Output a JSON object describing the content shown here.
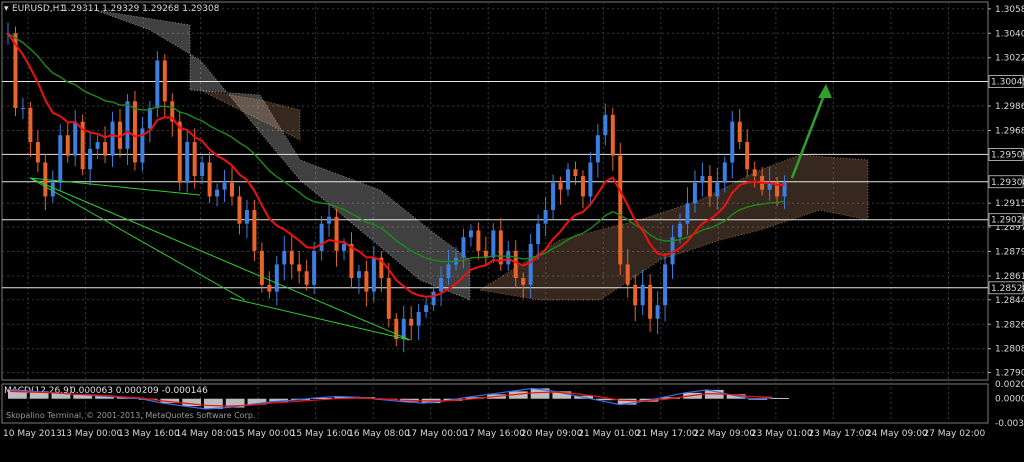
{
  "header": {
    "symbol_text": "EURUSD,H1",
    "ohlc_text": "1.29311 1.29329 1.29268 1.29308"
  },
  "macd_header": {
    "label": "MACD(12,26,9)",
    "values": "0.000063 0.000209 -0.000146"
  },
  "copyright": "Skopalino Terminal, © 2001-2013, MetaQuotes Software Corp.",
  "colors": {
    "bull_candle": "#3d7fe0",
    "bear_candle": "#e8642a",
    "ema_fast": "#ee1111",
    "ema_slow": "#1d8a1d",
    "cloud_white": "#e6e6e6",
    "cloud_orange": "#d9a079",
    "support_line": "#32cd32",
    "arrow": "#2da12d",
    "hline": "#e6e6e6",
    "macd_hist": "#bdbdbd",
    "macd_main": "#3b6de0",
    "macd_signal": "#ee1111"
  },
  "chart_data": [
    {
      "type": "candlestick",
      "title": "EURUSD,H1",
      "x_tick_labels": [
        "10 May 2013",
        "13 May 00:00",
        "13 May 16:00",
        "14 May 08:00",
        "15 May 00:00",
        "15 May 16:00",
        "16 May 08:00",
        "17 May 00:00",
        "17 May 16:00",
        "20 May 09:00",
        "21 May 01:00",
        "21 May 17:00",
        "22 May 09:00",
        "23 May 01:00",
        "23 May 17:00",
        "24 May 09:00",
        "27 May 02:00"
      ],
      "y_tick_labels": [
        "1.30580",
        "1.30400",
        "1.30220",
        "1.29865",
        "1.29685",
        "1.29150",
        "1.28975",
        "1.28795",
        "1.28615",
        "1.28440",
        "1.28260",
        "1.28080",
        "1.27905"
      ],
      "ylim": [
        1.2785,
        1.3063
      ],
      "horizontal_levels": [
        {
          "value": 1.30045,
          "label": "1.30045"
        },
        {
          "value": 1.29509,
          "label": "1.29509"
        },
        {
          "value": 1.29308,
          "label": "1.29308"
        },
        {
          "value": 1.29029,
          "label": "1.29029"
        },
        {
          "value": 1.28528,
          "label": "1.28528"
        }
      ],
      "ohlc_approx": [
        1.304,
        1.2985,
        1.2985,
        1.296,
        1.2945,
        1.292,
        1.293,
        1.2965,
        1.295,
        1.2975,
        1.294,
        1.2955,
        1.296,
        1.295,
        1.2975,
        1.2955,
        1.299,
        1.2945,
        1.297,
        1.2985,
        1.302,
        1.299,
        1.2975,
        1.293,
        1.296,
        1.2935,
        1.2945,
        1.292,
        1.2925,
        1.293,
        1.292,
        1.29,
        1.291,
        1.288,
        1.2855,
        1.285,
        1.287,
        1.288,
        1.287,
        1.2865,
        1.2855,
        1.288,
        1.29,
        1.2905,
        1.288,
        1.2885,
        1.286,
        1.2865,
        1.285,
        1.2875,
        1.286,
        1.283,
        1.2815,
        1.283,
        1.2825,
        1.2835,
        1.284,
        1.285,
        1.286,
        1.287,
        1.2875,
        1.289,
        1.2895,
        1.288,
        1.2875,
        1.2895,
        1.287,
        1.288,
        1.286,
        1.2855,
        1.2885,
        1.29,
        1.291,
        1.293,
        1.2925,
        1.294,
        1.2935,
        1.292,
        1.2945,
        1.2965,
        1.298,
        1.295,
        1.287,
        1.2855,
        1.284,
        1.2855,
        1.283,
        1.284,
        1.287,
        1.289,
        1.29,
        1.2915,
        1.293,
        1.2935,
        1.292,
        1.293,
        1.2945,
        1.2975,
        1.296,
        1.294,
        1.2935,
        1.2925,
        1.293,
        1.292,
        1.293
      ],
      "indicators": [
        "EMA fast (red)",
        "EMA slow (green)",
        "Ichimoku cloud (white/orange)",
        "trend lines (green)"
      ]
    },
    {
      "type": "bar",
      "title": "MACD(12,26,9)",
      "values_text": "0.000063 0.000209 -0.000146",
      "y_tick_labels": [
        "0.002014",
        "0.0000",
        "-0.003322"
      ],
      "series": [
        {
          "name": "MACD main",
          "values": [
            0.0012,
            0.001,
            0.0008,
            0.0006,
            0.0004,
            0.0002,
            0.0,
            -0.0006,
            -0.001,
            -0.0014,
            -0.0012,
            -0.0008,
            -0.0004,
            -0.0002,
            0.0001,
            0.0003,
            0.0002,
            -0.0001,
            -0.0004,
            -0.0006,
            -0.0003,
            0.0002,
            0.0006,
            0.001,
            0.0014,
            0.001,
            0.0004,
            -0.0002,
            -0.0008,
            -0.0004,
            0.0002,
            0.0008,
            0.0012,
            0.0006,
            0.0,
            0.0001
          ]
        },
        {
          "name": "Signal",
          "values": [
            0.001,
            0.0009,
            0.0008,
            0.0006,
            0.0005,
            0.0003,
            0.0001,
            -0.0003,
            -0.0006,
            -0.0009,
            -0.001,
            -0.0009,
            -0.0006,
            -0.0004,
            -0.0002,
            0.0,
            0.0001,
            0.0,
            -0.0002,
            -0.0003,
            -0.0003,
            -0.0001,
            0.0002,
            0.0005,
            0.0008,
            0.0009,
            0.0007,
            0.0003,
            -0.0002,
            -0.0003,
            -0.0001,
            0.0003,
            0.0007,
            0.0006,
            0.0003,
            0.0002
          ]
        }
      ]
    }
  ]
}
